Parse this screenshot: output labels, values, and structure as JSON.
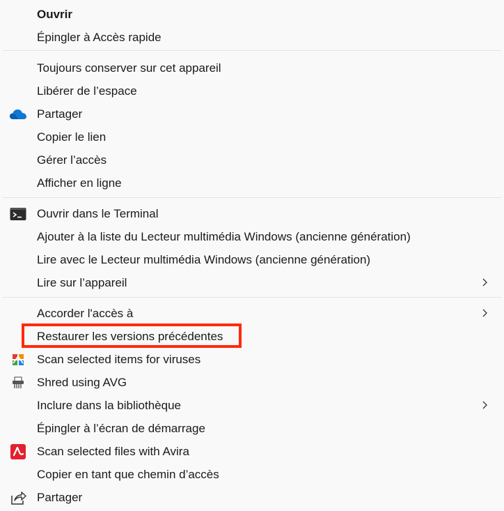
{
  "menu": {
    "items": [
      {
        "label": "Ouvrir",
        "bold": true
      },
      {
        "label": "Épingler à Accès rapide"
      },
      {
        "label": "Toujours conserver sur cet appareil"
      },
      {
        "label": "Libérer de l’espace"
      },
      {
        "label": "Partager",
        "icon": "onedrive-cloud-icon"
      },
      {
        "label": "Copier le lien"
      },
      {
        "label": "Gérer l’accès"
      },
      {
        "label": "Afficher en ligne"
      },
      {
        "label": "Ouvrir dans le Terminal",
        "icon": "terminal-icon"
      },
      {
        "label": "Ajouter à la liste du Lecteur multimédia Windows (ancienne génération)"
      },
      {
        "label": "Lire avec le Lecteur multimédia Windows (ancienne génération)"
      },
      {
        "label": "Lire sur l’appareil",
        "submenu": true
      },
      {
        "label": "Accorder l'accès à",
        "submenu": true
      },
      {
        "label": "Restaurer les versions précédentes",
        "highlighted": true
      },
      {
        "label": "Scan selected items for viruses",
        "icon": "avg-logo-icon"
      },
      {
        "label": "Shred using AVG",
        "icon": "shredder-icon"
      },
      {
        "label": "Inclure dans la bibliothèque",
        "submenu": true
      },
      {
        "label": "Épingler à l’écran de démarrage"
      },
      {
        "label": "Scan selected files with Avira",
        "icon": "avira-logo-icon"
      },
      {
        "label": "Copier en tant que chemin d’accès"
      },
      {
        "label": "Partager",
        "icon": "share-icon"
      }
    ]
  },
  "colors": {
    "highlight_border": "#ff2a0e",
    "onedrive_blue": "#0f78d4",
    "avira_red": "#e4202f",
    "separator": "#e3e3e3"
  }
}
